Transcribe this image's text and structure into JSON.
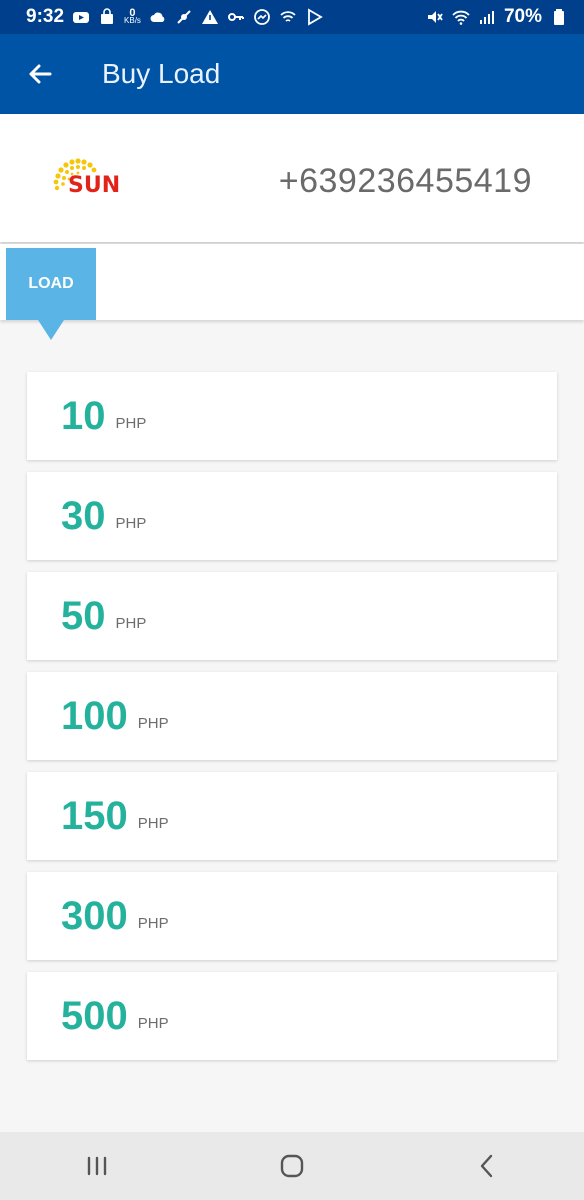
{
  "status_bar": {
    "time": "9:32",
    "net_speed_value": "0",
    "net_speed_unit": "KB/s",
    "battery_percent": "70%"
  },
  "app_bar": {
    "title": "Buy Load",
    "back_icon": "arrow-left-icon"
  },
  "operator": {
    "logo_text": "SUN",
    "phone_number": "+639236455419"
  },
  "tabs": {
    "active_label": "LOAD"
  },
  "load_options": [
    {
      "amount": "10",
      "currency": "PHP"
    },
    {
      "amount": "30",
      "currency": "PHP"
    },
    {
      "amount": "50",
      "currency": "PHP"
    },
    {
      "amount": "100",
      "currency": "PHP"
    },
    {
      "amount": "150",
      "currency": "PHP"
    },
    {
      "amount": "300",
      "currency": "PHP"
    },
    {
      "amount": "500",
      "currency": "PHP"
    }
  ],
  "nav_bar": {
    "recent_icon": "recent-apps-icon",
    "home_icon": "home-icon",
    "back_icon": "back-icon"
  },
  "colors": {
    "status_bar": "#003f8c",
    "app_bar": "#0054a6",
    "tab_active": "#5ab4e5",
    "amount_text": "#25b29d"
  }
}
